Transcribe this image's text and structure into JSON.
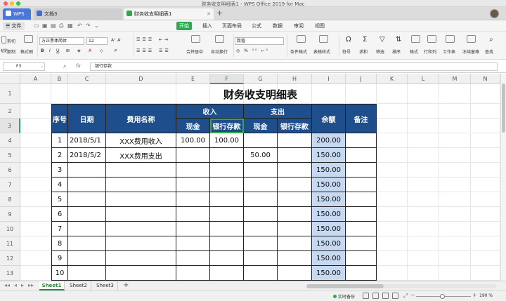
{
  "window": {
    "title": "财务收支明细表1 - WPS Office 2019 for Mac"
  },
  "tabs": [
    {
      "label": "WPS",
      "icon": "wps-logo-icon"
    },
    {
      "label": "文档3",
      "icon": "writer-doc-icon"
    },
    {
      "label": "财务收支明细表1",
      "icon": "sheet-doc-icon"
    }
  ],
  "menu": {
    "file": "文件",
    "items": [
      "开始",
      "插入",
      "页面布局",
      "公式",
      "数据",
      "审阅",
      "视图"
    ]
  },
  "toolbar": {
    "cut": "剪切",
    "paste": "粘贴",
    "copy": "复制",
    "format_painter": "格式刷",
    "font": "方正黑体简体",
    "size": "12",
    "merge": "合并居中",
    "wrap": "自动换行",
    "number_format": "数值",
    "cond_format": "条件格式",
    "table_style": "表格样式",
    "symbol": "符号",
    "sum": "求和",
    "filter": "筛选",
    "sort": "排序",
    "format": "格式",
    "rowcol": "行和列",
    "worksheet": "工作表",
    "freeze": "冻结窗格",
    "find": "查找"
  },
  "formula": {
    "cell": "F3",
    "fx": "fx",
    "value": "银行存款"
  },
  "columns": [
    "A",
    "B",
    "C",
    "D",
    "E",
    "F",
    "G",
    "H",
    "I",
    "J",
    "K",
    "L",
    "M",
    "N"
  ],
  "rows": [
    "1",
    "2",
    "3",
    "4",
    "5",
    "6",
    "7",
    "8",
    "9",
    "10",
    "11",
    "12",
    "13"
  ],
  "sheet": {
    "title": "财务收支明细表",
    "h_seq": "序号",
    "h_date": "日期",
    "h_name": "费用名称",
    "h_income": "收入",
    "h_expense": "支出",
    "h_balance": "余额",
    "h_note": "备注",
    "h_cash": "现金",
    "h_bank": "银行存款",
    "data": [
      [
        "1",
        "2018/5/1",
        "XXX费用收入",
        "100.00",
        "100.00",
        "",
        "",
        "200.00",
        ""
      ],
      [
        "2",
        "2018/5/2",
        "XXX费用支出",
        "",
        "",
        "50.00",
        "",
        "150.00",
        ""
      ],
      [
        "3",
        "",
        "",
        "",
        "",
        "",
        "",
        "150.00",
        ""
      ],
      [
        "4",
        "",
        "",
        "",
        "",
        "",
        "",
        "150.00",
        ""
      ],
      [
        "5",
        "",
        "",
        "",
        "",
        "",
        "",
        "150.00",
        ""
      ],
      [
        "6",
        "",
        "",
        "",
        "",
        "",
        "",
        "150.00",
        ""
      ],
      [
        "7",
        "",
        "",
        "",
        "",
        "",
        "",
        "150.00",
        ""
      ],
      [
        "8",
        "",
        "",
        "",
        "",
        "",
        "",
        "150.00",
        ""
      ],
      [
        "9",
        "",
        "",
        "",
        "",
        "",
        "",
        "150.00",
        ""
      ],
      [
        "10",
        "",
        "",
        "",
        "",
        "",
        "",
        "150.00",
        ""
      ]
    ]
  },
  "sheet_tabs": [
    "Sheet1",
    "Sheet2",
    "Sheet3"
  ],
  "status": {
    "backup": "实时备份",
    "zoom": "190 %"
  },
  "colors": {
    "header_fill": "#1f4e8c",
    "balance_fill": "#c6d9f0",
    "accent": "#2fa84f",
    "wps_tab": "#4a78d6"
  }
}
